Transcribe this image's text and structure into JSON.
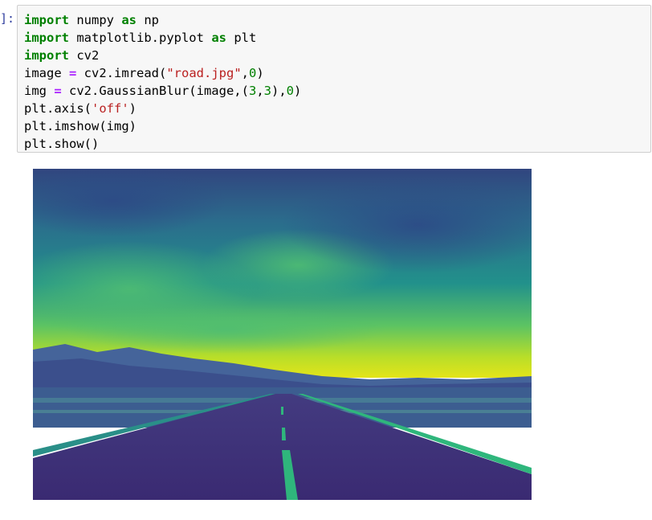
{
  "prompt": {
    "label": "]:"
  },
  "code": {
    "lines": [
      [
        {
          "t": "import",
          "c": "kw"
        },
        {
          "t": " numpy ",
          "c": ""
        },
        {
          "t": "as",
          "c": "kw"
        },
        {
          "t": " np",
          "c": ""
        }
      ],
      [
        {
          "t": "import",
          "c": "kw"
        },
        {
          "t": " matplotlib.pyplot ",
          "c": ""
        },
        {
          "t": "as",
          "c": "kw"
        },
        {
          "t": " plt",
          "c": ""
        }
      ],
      [
        {
          "t": "import",
          "c": "kw"
        },
        {
          "t": " cv2",
          "c": ""
        }
      ],
      [
        {
          "t": "image ",
          "c": ""
        },
        {
          "t": "=",
          "c": "op"
        },
        {
          "t": " cv2.imread(",
          "c": ""
        },
        {
          "t": "\"road.jpg\"",
          "c": "str"
        },
        {
          "t": ",",
          "c": ""
        },
        {
          "t": "0",
          "c": "num"
        },
        {
          "t": ")",
          "c": ""
        }
      ],
      [
        {
          "t": "img ",
          "c": ""
        },
        {
          "t": "=",
          "c": "op"
        },
        {
          "t": " cv2.GaussianBlur(image,(",
          "c": ""
        },
        {
          "t": "3",
          "c": "num"
        },
        {
          "t": ",",
          "c": ""
        },
        {
          "t": "3",
          "c": "num"
        },
        {
          "t": "),",
          "c": ""
        },
        {
          "t": "0",
          "c": "num"
        },
        {
          "t": ")",
          "c": ""
        }
      ],
      [
        {
          "t": "plt.axis(",
          "c": ""
        },
        {
          "t": "'off'",
          "c": "str"
        },
        {
          "t": ")",
          "c": ""
        }
      ],
      [
        {
          "t": "plt.imshow(img)",
          "c": ""
        }
      ],
      [
        {
          "t": "plt.show()",
          "c": ""
        }
      ]
    ]
  },
  "output": {
    "image_icon": "viridis-road-landscape-image",
    "colors": {
      "sky_top": "#2f5f8e",
      "sky_mid": "#2a8a8c",
      "horizon": "#dfe31a",
      "mountains": "#3b4f8c",
      "road": "#3a2a70",
      "road_edge": "#24a884",
      "center_line": "#2fb67c"
    }
  }
}
